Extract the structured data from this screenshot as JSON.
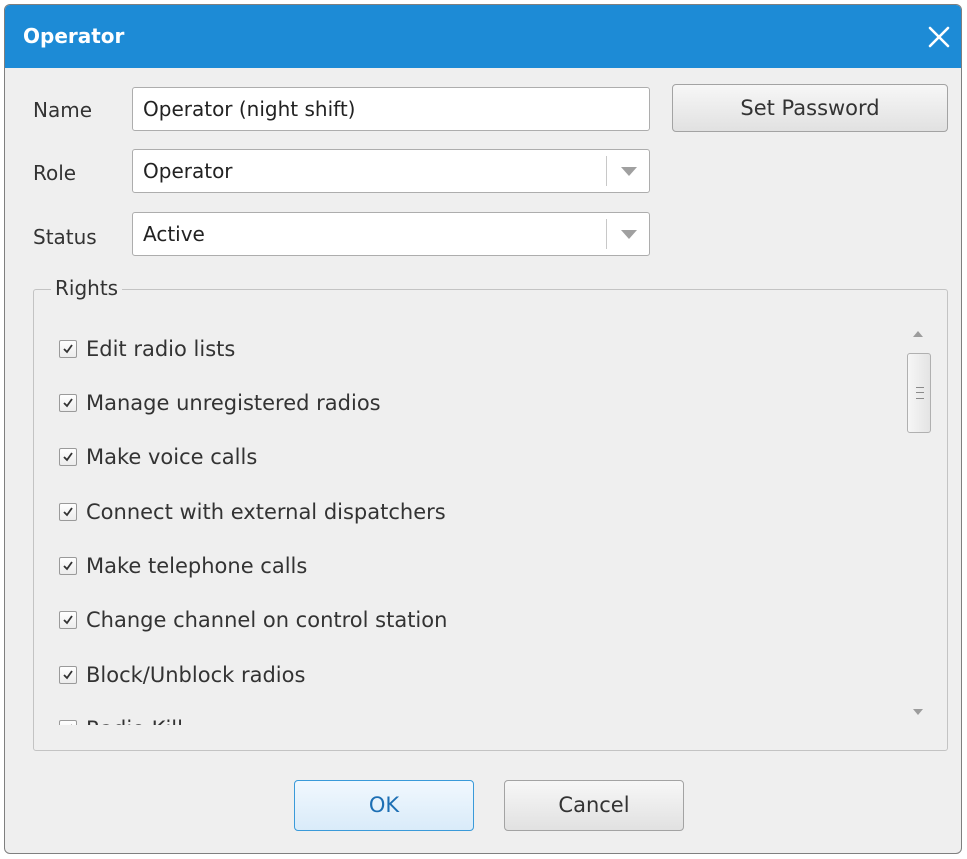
{
  "window": {
    "title": "Operator",
    "title_bar_color": "#1d8bd6",
    "close_icon": "close-icon"
  },
  "form": {
    "name_label": "Name",
    "name_value": "Operator (night shift)",
    "set_password_label": "Set Password",
    "role_label": "Role",
    "role_value": "Operator",
    "status_label": "Status",
    "status_value": "Active"
  },
  "rights": {
    "group_label": "Rights",
    "items": [
      {
        "label": "Edit radio lists",
        "checked": true
      },
      {
        "label": "Manage unregistered radios",
        "checked": true
      },
      {
        "label": "Make voice calls",
        "checked": true
      },
      {
        "label": "Connect with external dispatchers",
        "checked": true
      },
      {
        "label": "Make telephone calls",
        "checked": true
      },
      {
        "label": "Change channel on control station",
        "checked": true
      },
      {
        "label": "Block/Unblock radios",
        "checked": true
      },
      {
        "label": "Radio Kill",
        "checked": true
      }
    ]
  },
  "buttons": {
    "ok_label": "OK",
    "cancel_label": "Cancel"
  }
}
